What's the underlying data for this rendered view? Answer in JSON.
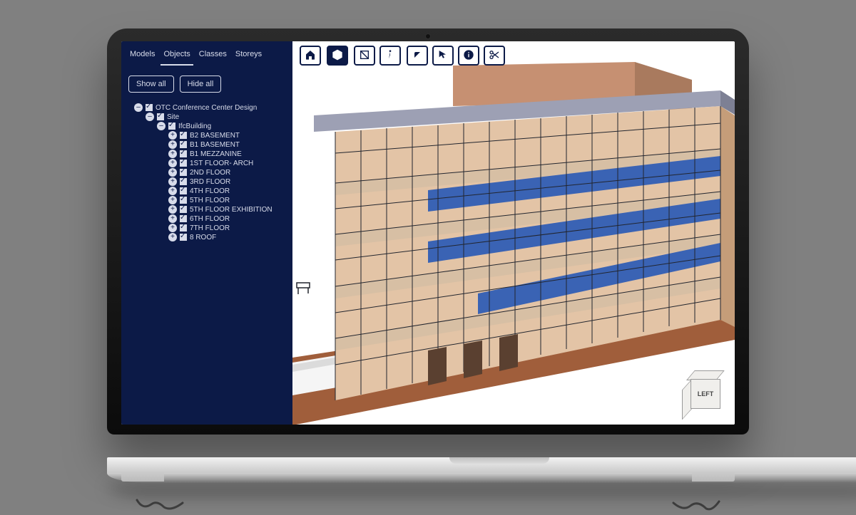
{
  "tabs": [
    "Models",
    "Objects",
    "Classes",
    "Storeys"
  ],
  "active_tab_index": 1,
  "actions": {
    "show_all": "Show all",
    "hide_all": "Hide all"
  },
  "tree": {
    "label": "OTC Conference Center Design",
    "children": [
      {
        "label": "Site",
        "children": [
          {
            "label": "IfcBuilding",
            "children": [
              {
                "label": "B2 BASEMENT"
              },
              {
                "label": "B1 BASEMENT"
              },
              {
                "label": "B1 MEZZANINE"
              },
              {
                "label": "1ST FLOOR- ARCH"
              },
              {
                "label": "2ND FLOOR"
              },
              {
                "label": "3RD FLOOR"
              },
              {
                "label": "4TH FLOOR"
              },
              {
                "label": "5TH FLOOR"
              },
              {
                "label": "5TH FLOOR EXHIBITION"
              },
              {
                "label": "6TH FLOOR"
              },
              {
                "label": "7TH FLOOR"
              },
              {
                "label": "8 ROOF"
              }
            ]
          }
        ]
      }
    ]
  },
  "toolbar": {
    "groups": [
      [
        "home"
      ],
      [
        "cube"
      ],
      [
        "section",
        "walk"
      ],
      [
        "hide",
        "select",
        "info",
        "snip"
      ]
    ],
    "active": "cube"
  },
  "nav_cube": {
    "top": "",
    "side": "",
    "front": "LEFT"
  }
}
